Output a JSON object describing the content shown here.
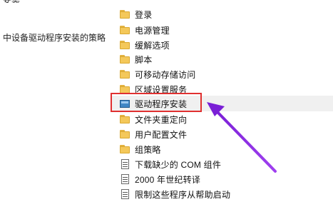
{
  "left_pane": {
    "top_cut_text": "安装",
    "description": "中设备驱动程序安装的策略"
  },
  "tree": {
    "items": [
      {
        "label": "登录",
        "icon": "folder-icon"
      },
      {
        "label": "电源管理",
        "icon": "folder-icon"
      },
      {
        "label": "缓解选项",
        "icon": "folder-icon"
      },
      {
        "label": "脚本",
        "icon": "folder-icon"
      },
      {
        "label": "可移动存储访问",
        "icon": "folder-icon"
      },
      {
        "label": "区域设置服务",
        "icon": "folder-icon"
      },
      {
        "label": "驱动程序安装",
        "icon": "policy-folder-icon",
        "selected": true
      },
      {
        "label": "文件夹重定向",
        "icon": "folder-icon"
      },
      {
        "label": "用户配置文件",
        "icon": "folder-icon"
      },
      {
        "label": "组策略",
        "icon": "folder-icon"
      },
      {
        "label": "下载缺少的 COM 组件",
        "icon": "setting-document-icon"
      },
      {
        "label": "2000 年世纪转译",
        "icon": "setting-document-icon"
      },
      {
        "label": "限制这些程序从帮助启动",
        "icon": "setting-document-icon"
      }
    ]
  },
  "colors": {
    "highlight_box": "#e03030",
    "arrow": "#8a2be2",
    "folder": "#f4c85a",
    "policy_folder": "#3f87c5"
  }
}
